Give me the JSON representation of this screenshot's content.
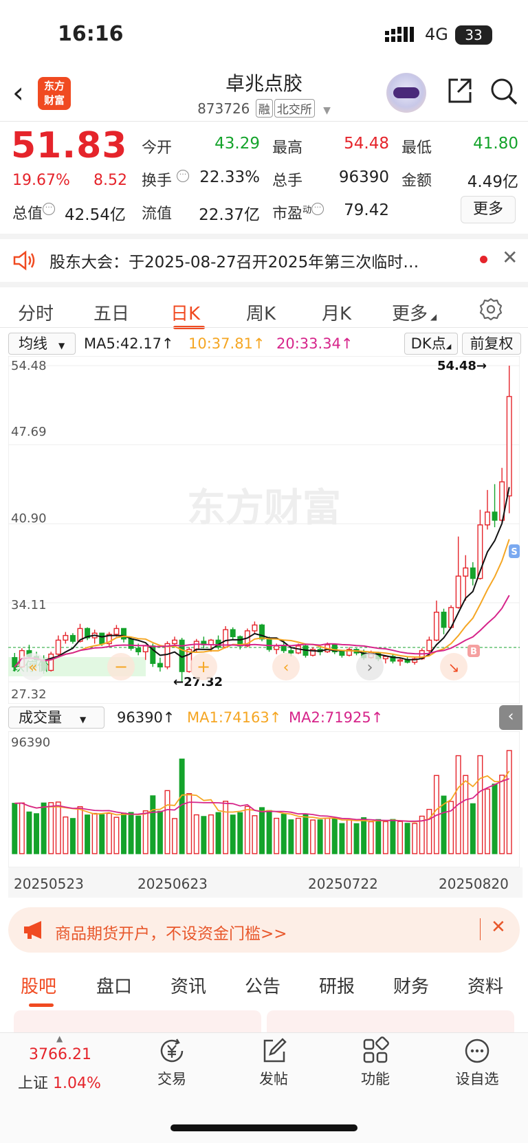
{
  "status": {
    "time": "16:16",
    "network": "4G",
    "battery": "33"
  },
  "header": {
    "title": "卓兆点胶",
    "code": "873726",
    "tag_margin": "融",
    "tag_market": "北交所",
    "logo_line1": "东方",
    "logo_line2": "财富"
  },
  "quote": {
    "price": "51.83",
    "pct": "19.67%",
    "change": "8.52",
    "open_label": "今开",
    "open": "43.29",
    "high_label": "最高",
    "high": "54.48",
    "low_label": "最低",
    "low": "41.80",
    "turnover_label": "换手",
    "turnover": "22.33%",
    "volume_label": "总手",
    "volume": "96390",
    "amount_label": "金额",
    "amount": "4.49亿",
    "mktcap_label": "总值",
    "mktcap": "42.54亿",
    "float_label": "流值",
    "float_cap": "22.37亿",
    "pe_label": "市盈",
    "pe_sup": "动",
    "pe": "79.42",
    "more": "更多"
  },
  "notice": {
    "text": "股东大会：于2025-08-27召开2025年第三次临时…"
  },
  "chart_tabs": [
    "分时",
    "五日",
    "日K",
    "周K",
    "月K",
    "更多"
  ],
  "active_chart_tab": 2,
  "indicator": {
    "dropdown": "均线",
    "ma5": "MA5:42.17↑",
    "ma10": "10:37.81↑",
    "ma20": "20:33.34↑",
    "dk": "DK点",
    "adjust": "前复权"
  },
  "volume_bar": {
    "dropdown": "成交量",
    "value": "96390↑",
    "ma1": "MA1:74163↑",
    "ma2": "MA2:71925↑"
  },
  "price_axis": {
    "top": "54.48",
    "l2": "47.69",
    "l3": "40.90",
    "l4": "34.11",
    "bottom": "27.32",
    "high_mark": "54.48→",
    "low_mark": "←27.32",
    "limit_label": "跌停价："
  },
  "volume_axis": {
    "top": "96390"
  },
  "dates": [
    "20250523",
    "20250623",
    "20250722",
    "20250820"
  ],
  "chart_data": {
    "type": "candlestick",
    "title": "",
    "y_ticks": [
      54.48,
      47.69,
      40.9,
      34.11,
      27.32
    ],
    "ylim": [
      27.32,
      54.48
    ],
    "x_ticks": [
      "20250523",
      "20250623",
      "20250722",
      "20250820"
    ],
    "candles_ohlc": [
      [
        29.4,
        29.8,
        28.2,
        28.6
      ],
      [
        28.6,
        30.2,
        28.5,
        30.0
      ],
      [
        30.0,
        30.5,
        29.3,
        29.5
      ],
      [
        29.5,
        29.9,
        28.8,
        29.2
      ],
      [
        29.2,
        29.6,
        28.0,
        28.3
      ],
      [
        28.3,
        29.9,
        28.2,
        29.7
      ],
      [
        29.7,
        31.3,
        29.5,
        30.9
      ],
      [
        30.9,
        31.6,
        30.6,
        31.3
      ],
      [
        31.3,
        31.5,
        30.6,
        30.8
      ],
      [
        30.8,
        32.3,
        30.7,
        31.9
      ],
      [
        31.9,
        32.0,
        30.9,
        31.1
      ],
      [
        31.1,
        31.8,
        30.6,
        31.5
      ],
      [
        31.5,
        31.5,
        30.4,
        30.6
      ],
      [
        30.6,
        31.6,
        30.4,
        31.4
      ],
      [
        31.4,
        32.2,
        31.2,
        31.9
      ],
      [
        31.9,
        31.9,
        30.7,
        31.0
      ],
      [
        31.0,
        31.2,
        30.0,
        30.2
      ],
      [
        30.2,
        30.6,
        29.6,
        29.9
      ],
      [
        29.9,
        30.5,
        29.2,
        30.4
      ],
      [
        30.4,
        30.6,
        28.6,
        28.9
      ],
      [
        28.9,
        29.4,
        28.2,
        28.6
      ],
      [
        28.6,
        30.8,
        28.4,
        30.6
      ],
      [
        30.6,
        31.2,
        30.3,
        30.9
      ],
      [
        30.9,
        31.1,
        27.32,
        28.2
      ],
      [
        28.2,
        30.3,
        28.1,
        30.1
      ],
      [
        30.1,
        31.0,
        29.9,
        30.8
      ],
      [
        30.8,
        31.2,
        30.2,
        30.5
      ],
      [
        30.5,
        31.0,
        29.9,
        30.9
      ],
      [
        30.9,
        31.3,
        30.1,
        30.3
      ],
      [
        30.3,
        32.1,
        30.2,
        31.8
      ],
      [
        31.8,
        32.0,
        30.9,
        31.2
      ],
      [
        31.2,
        31.3,
        30.1,
        30.4
      ],
      [
        30.4,
        31.9,
        30.3,
        31.7
      ],
      [
        31.7,
        32.5,
        31.4,
        32.2
      ],
      [
        32.2,
        32.3,
        30.8,
        31.0
      ],
      [
        31.0,
        31.2,
        29.9,
        30.1
      ],
      [
        30.1,
        30.6,
        29.7,
        30.4
      ],
      [
        30.4,
        30.9,
        29.8,
        30.0
      ],
      [
        30.0,
        30.3,
        29.5,
        29.8
      ],
      [
        29.8,
        30.6,
        29.7,
        30.4
      ],
      [
        30.4,
        30.5,
        29.4,
        29.6
      ],
      [
        29.6,
        30.3,
        29.5,
        30.1
      ],
      [
        30.1,
        30.4,
        29.6,
        29.9
      ],
      [
        29.9,
        30.7,
        29.8,
        30.5
      ],
      [
        30.5,
        30.6,
        29.7,
        29.9
      ],
      [
        29.9,
        30.0,
        29.4,
        29.6
      ],
      [
        29.6,
        30.3,
        29.5,
        30.1
      ],
      [
        30.1,
        30.2,
        29.6,
        29.8
      ],
      [
        29.8,
        30.1,
        29.2,
        29.4
      ],
      [
        29.4,
        30.0,
        29.3,
        29.8
      ],
      [
        29.8,
        29.9,
        29.1,
        29.3
      ],
      [
        29.3,
        29.6,
        28.9,
        29.5
      ],
      [
        29.5,
        29.7,
        28.9,
        29.1
      ],
      [
        29.1,
        29.4,
        28.7,
        29.2
      ],
      [
        29.2,
        29.5,
        28.9,
        29.0
      ],
      [
        29.0,
        29.4,
        28.8,
        29.3
      ],
      [
        29.3,
        30.2,
        29.2,
        30.0
      ],
      [
        30.0,
        31.2,
        29.8,
        30.9
      ],
      [
        30.9,
        34.3,
        30.8,
        33.3
      ],
      [
        33.3,
        33.6,
        31.4,
        32.0
      ],
      [
        32.0,
        33.9,
        31.9,
        33.7
      ],
      [
        33.7,
        39.8,
        33.6,
        36.4
      ],
      [
        36.4,
        38.2,
        34.3,
        37.1
      ],
      [
        37.1,
        37.6,
        35.6,
        36.2
      ],
      [
        36.2,
        42.1,
        36.1,
        40.8
      ],
      [
        40.8,
        43.8,
        40.4,
        41.9
      ],
      [
        41.9,
        44.3,
        40.6,
        41.2
      ],
      [
        41.2,
        45.7,
        41.0,
        44.5
      ],
      [
        43.29,
        54.48,
        41.8,
        51.83
      ]
    ]
  }
}
